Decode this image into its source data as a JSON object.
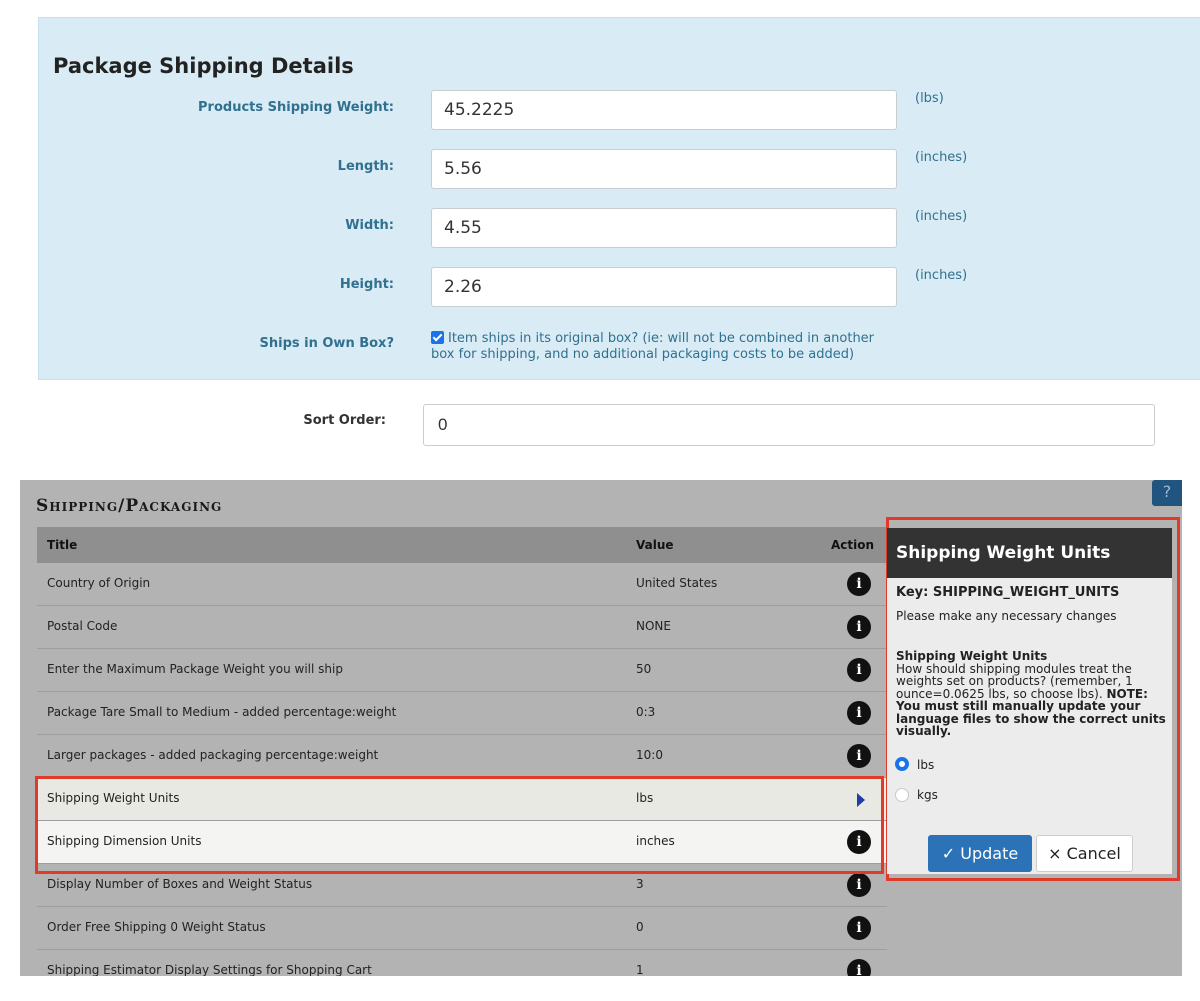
{
  "package": {
    "title": "Package Shipping Details",
    "weight_label": "Products Shipping Weight:",
    "weight_value": "45.2225",
    "weight_unit": "(lbs)",
    "length_label": "Length:",
    "length_value": "5.56",
    "length_unit": "(inches)",
    "width_label": "Width:",
    "width_value": "4.55",
    "width_unit": "(inches)",
    "height_label": "Height:",
    "height_value": "2.26",
    "height_unit": "(inches)",
    "own_box_label": "Ships in Own Box?",
    "own_box_text": "Item ships in its original box? (ie: will not be combined in another box for shipping, and no additional packaging costs to be added)",
    "own_box_checked": true
  },
  "sort": {
    "label": "Sort Order:",
    "value": "0"
  },
  "admin": {
    "help": "?",
    "section_title": "Shipping/Packaging",
    "columns": {
      "title": "Title",
      "value": "Value",
      "action": "Action"
    },
    "rows": [
      {
        "title": "Country of Origin",
        "value": "United States",
        "action": "info"
      },
      {
        "title": "Postal Code",
        "value": "NONE",
        "action": "info"
      },
      {
        "title": "Enter the Maximum Package Weight you will ship",
        "value": "50",
        "action": "info"
      },
      {
        "title": "Package Tare Small to Medium - added percentage:weight",
        "value": "0:3",
        "action": "info"
      },
      {
        "title": "Larger packages - added packaging percentage:weight",
        "value": "10:0",
        "action": "info"
      },
      {
        "title": "Shipping Weight Units",
        "value": "lbs",
        "action": "selected"
      },
      {
        "title": "Shipping Dimension Units",
        "value": "inches",
        "action": "info"
      },
      {
        "title": "Display Number of Boxes and Weight Status",
        "value": "3",
        "action": "info"
      },
      {
        "title": "Order Free Shipping 0 Weight Status",
        "value": "0",
        "action": "info"
      },
      {
        "title": "Shipping Estimator Display Settings for Shopping Cart",
        "value": "1",
        "action": "info"
      }
    ]
  },
  "edit": {
    "heading": "Shipping Weight Units",
    "key": "Key: SHIPPING_WEIGHT_UNITS",
    "instructions": "Please make any necessary changes",
    "field_title": "Shipping Weight Units",
    "field_desc": "How should shipping modules treat the weights set on products? (remember, 1 ounce=0.0625 lbs, so choose lbs).",
    "field_note": "NOTE: You must still manually update your language files to show the correct units visually.",
    "options": [
      {
        "label": "lbs",
        "selected": true
      },
      {
        "label": "kgs",
        "selected": false
      }
    ],
    "update_label": "✓ Update",
    "cancel_label": "× Cancel"
  },
  "colors": {
    "panel_bg": "#d9ecf5",
    "label_blue": "#31708f",
    "highlight_red": "#e03a2b",
    "primary_button": "#2b73b6",
    "overlay_gray": "#b3b3b3"
  }
}
